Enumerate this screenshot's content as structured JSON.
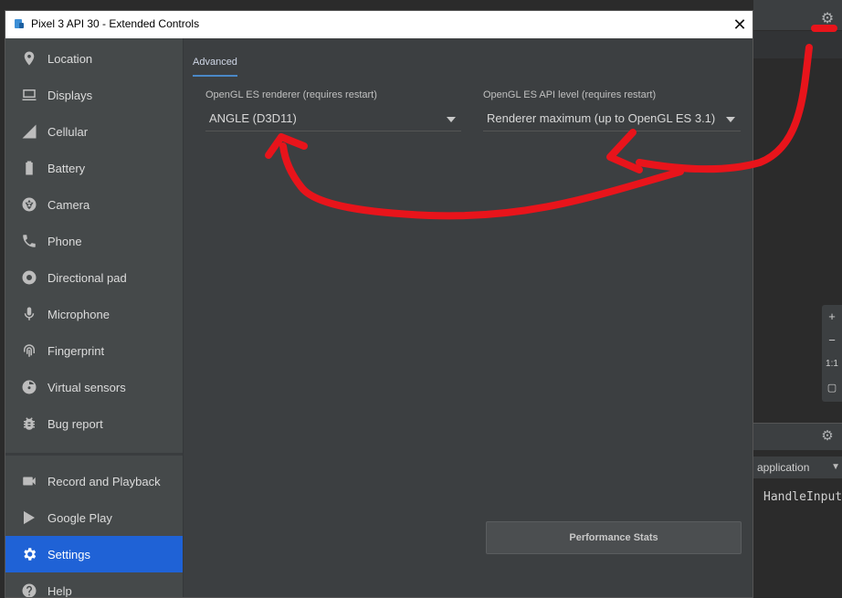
{
  "window": {
    "title": "Pixel 3 API 30 - Extended Controls",
    "close_glyph": "✕"
  },
  "sidebar": {
    "items": [
      {
        "label": "Location",
        "icon": "location-pin-icon"
      },
      {
        "label": "Displays",
        "icon": "display-icon"
      },
      {
        "label": "Cellular",
        "icon": "cellular-signal-icon"
      },
      {
        "label": "Battery",
        "icon": "battery-icon"
      },
      {
        "label": "Camera",
        "icon": "camera-aperture-icon"
      },
      {
        "label": "Phone",
        "icon": "phone-icon"
      },
      {
        "label": "Directional pad",
        "icon": "dpad-icon"
      },
      {
        "label": "Microphone",
        "icon": "microphone-icon"
      },
      {
        "label": "Fingerprint",
        "icon": "fingerprint-icon"
      },
      {
        "label": "Virtual sensors",
        "icon": "virtual-sensors-icon"
      },
      {
        "label": "Bug report",
        "icon": "bug-icon"
      },
      {
        "label": "Record and Playback",
        "icon": "video-camera-icon"
      },
      {
        "label": "Google Play",
        "icon": "play-store-icon"
      },
      {
        "label": "Settings",
        "icon": "gear-icon"
      },
      {
        "label": "Help",
        "icon": "help-icon"
      }
    ],
    "active": "Settings"
  },
  "content": {
    "tab_label": "Advanced",
    "renderer_label": "OpenGL ES renderer (requires restart)",
    "renderer_value": "ANGLE (D3D11)",
    "api_level_label": "OpenGL ES API level (requires restart)",
    "api_level_value": "Renderer maximum (up to OpenGL ES 3.1)",
    "perf_button": "Performance Stats"
  },
  "background": {
    "filter_value": "application",
    "log_text": "HandleInput",
    "zoom_in": "+",
    "zoom_out": "−",
    "zoom_actual": "1:1"
  },
  "colors": {
    "accent": "#1f62d6",
    "annotation": "#e8141b"
  }
}
